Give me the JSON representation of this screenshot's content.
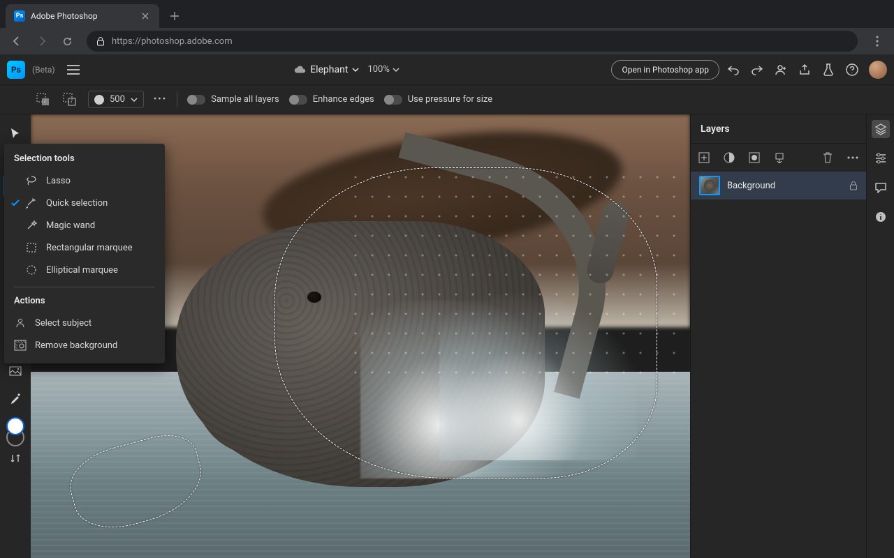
{
  "browser": {
    "tab_title": "Adobe Photoshop",
    "url": "https://photoshop.adobe.com"
  },
  "header": {
    "logo_text": "Ps",
    "beta_label": "(Beta)",
    "document_name": "Elephant",
    "zoom_level": "100%",
    "open_app_label": "Open in Photoshop app"
  },
  "options_bar": {
    "brush_size": "500",
    "toggles": {
      "sample_all": "Sample all layers",
      "enhance_edges": "Enhance edges",
      "pressure_size": "Use pressure for size"
    }
  },
  "flyout": {
    "section_tools": "Selection tools",
    "section_actions": "Actions",
    "items": {
      "lasso": "Lasso",
      "quick_selection": "Quick selection",
      "magic_wand": "Magic wand",
      "rect_marquee": "Rectangular marquee",
      "ellipse_marquee": "Elliptical marquee"
    },
    "actions": {
      "select_subject": "Select subject",
      "remove_bg": "Remove background"
    }
  },
  "layers": {
    "panel_title": "Layers",
    "items": [
      {
        "name": "Background",
        "locked": true
      }
    ]
  }
}
